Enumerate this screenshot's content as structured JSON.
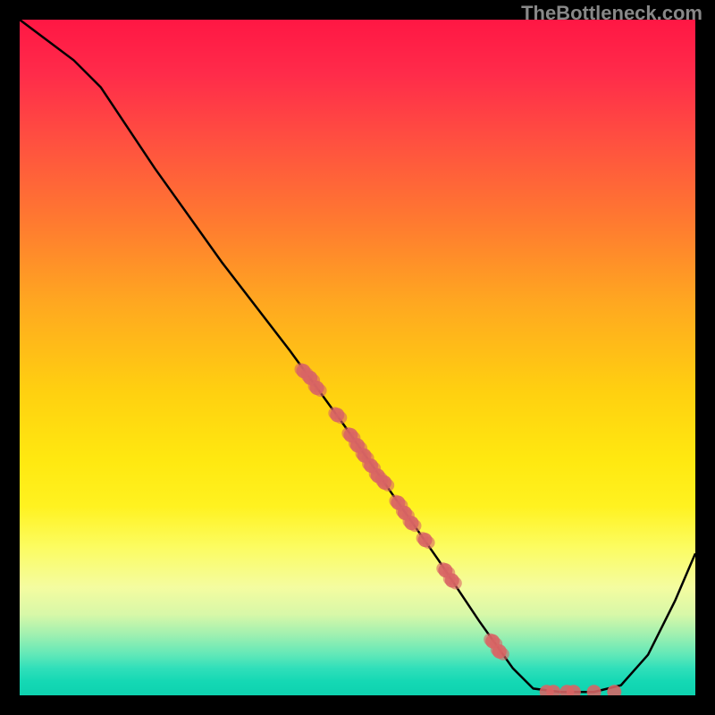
{
  "watermark": "TheBottleneck.com",
  "chart_data": {
    "type": "line",
    "title": "",
    "xlabel": "",
    "ylabel": "",
    "xlim": [
      0,
      100
    ],
    "ylim": [
      0,
      100
    ],
    "curve": [
      {
        "x": 0,
        "y": 100
      },
      {
        "x": 8,
        "y": 94
      },
      {
        "x": 12,
        "y": 90
      },
      {
        "x": 20,
        "y": 78
      },
      {
        "x": 30,
        "y": 64
      },
      {
        "x": 40,
        "y": 51
      },
      {
        "x": 48,
        "y": 40
      },
      {
        "x": 55,
        "y": 30
      },
      {
        "x": 62,
        "y": 20
      },
      {
        "x": 68,
        "y": 11
      },
      {
        "x": 73,
        "y": 4
      },
      {
        "x": 76,
        "y": 1
      },
      {
        "x": 80,
        "y": 0.5
      },
      {
        "x": 85,
        "y": 0.5
      },
      {
        "x": 89,
        "y": 1.5
      },
      {
        "x": 93,
        "y": 6
      },
      {
        "x": 97,
        "y": 14
      },
      {
        "x": 100,
        "y": 21
      }
    ],
    "data_points_on_curve": [
      {
        "x": 42,
        "y": 48
      },
      {
        "x": 43,
        "y": 47
      },
      {
        "x": 44,
        "y": 45.5
      },
      {
        "x": 47,
        "y": 41.5
      },
      {
        "x": 49,
        "y": 38.5
      },
      {
        "x": 50,
        "y": 37
      },
      {
        "x": 51,
        "y": 35.5
      },
      {
        "x": 52,
        "y": 34
      },
      {
        "x": 53,
        "y": 32.5
      },
      {
        "x": 54,
        "y": 31.5
      },
      {
        "x": 56,
        "y": 28.5
      },
      {
        "x": 57,
        "y": 27
      },
      {
        "x": 58,
        "y": 25.5
      },
      {
        "x": 60,
        "y": 23
      },
      {
        "x": 63,
        "y": 18.5
      },
      {
        "x": 64,
        "y": 17
      },
      {
        "x": 70,
        "y": 8
      },
      {
        "x": 71,
        "y": 6.5
      }
    ],
    "data_points_bottom": [
      {
        "x": 78,
        "y": 0.5
      },
      {
        "x": 79,
        "y": 0.5
      },
      {
        "x": 81,
        "y": 0.5
      },
      {
        "x": 82,
        "y": 0.5
      },
      {
        "x": 85,
        "y": 0.5
      },
      {
        "x": 88,
        "y": 0.5
      }
    ],
    "colors": {
      "curve": "#000000",
      "dots": "#d86464",
      "bg_top": "#ff1744",
      "bg_bottom": "#0ed2af"
    }
  }
}
